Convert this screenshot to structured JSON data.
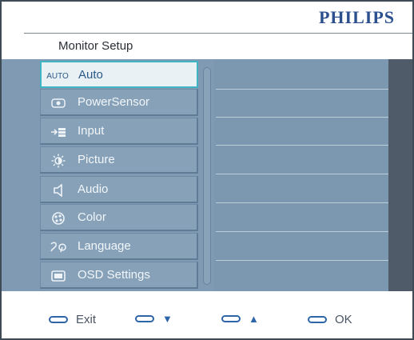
{
  "brand": "PHILIPS",
  "title": "Monitor Setup",
  "menu": [
    {
      "label": "Auto",
      "icon_text": "AUTO",
      "selected": true
    },
    {
      "label": "PowerSensor",
      "icon": "power-sensor-icon"
    },
    {
      "label": "Input",
      "icon": "input-icon"
    },
    {
      "label": "Picture",
      "icon": "picture-icon"
    },
    {
      "label": "Audio",
      "icon": "audio-icon"
    },
    {
      "label": "Color",
      "icon": "color-icon"
    },
    {
      "label": "Language",
      "icon": "language-icon"
    },
    {
      "label": "OSD Settings",
      "icon": "osd-settings-icon"
    }
  ],
  "footer": {
    "exit": "Exit",
    "down": "▼",
    "up": "▲",
    "ok": "OK"
  },
  "colors": {
    "brand": "#2b4f8f",
    "accent": "#3fb5c4",
    "panel": "#7f9ab2"
  }
}
